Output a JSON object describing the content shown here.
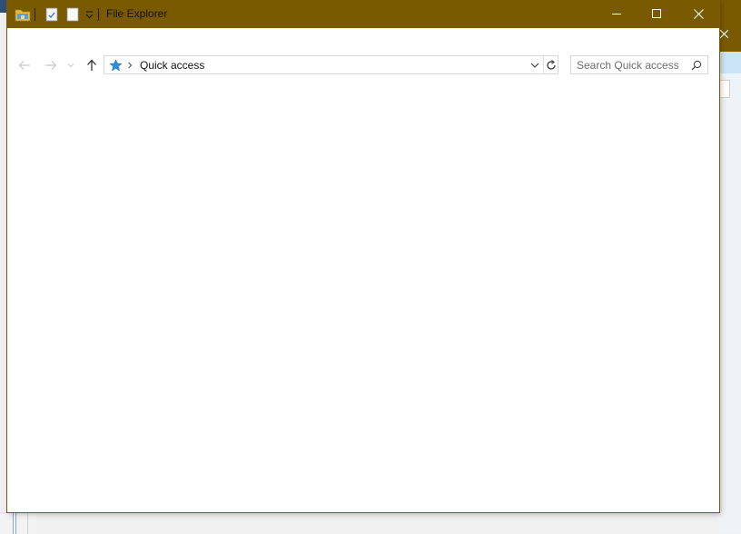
{
  "window": {
    "title": "File Explorer",
    "accent_color": "#7a5a00"
  },
  "quick_access_toolbar": {
    "items": [
      "folder-icon",
      "properties-icon",
      "new-folder-icon",
      "customize-dropdown-icon"
    ]
  },
  "caption_buttons": {
    "minimize": "minimize-icon",
    "maximize": "maximize-icon",
    "close": "close-icon"
  },
  "navigation": {
    "back": "arrow-left-icon",
    "forward": "arrow-right-icon",
    "recent": "chevron-down-icon",
    "up": "arrow-up-icon"
  },
  "address_bar": {
    "location_icon": "quick-access-star-icon",
    "path": [
      "Quick access"
    ]
  },
  "search": {
    "placeholder": "Search Quick access",
    "value": ""
  }
}
